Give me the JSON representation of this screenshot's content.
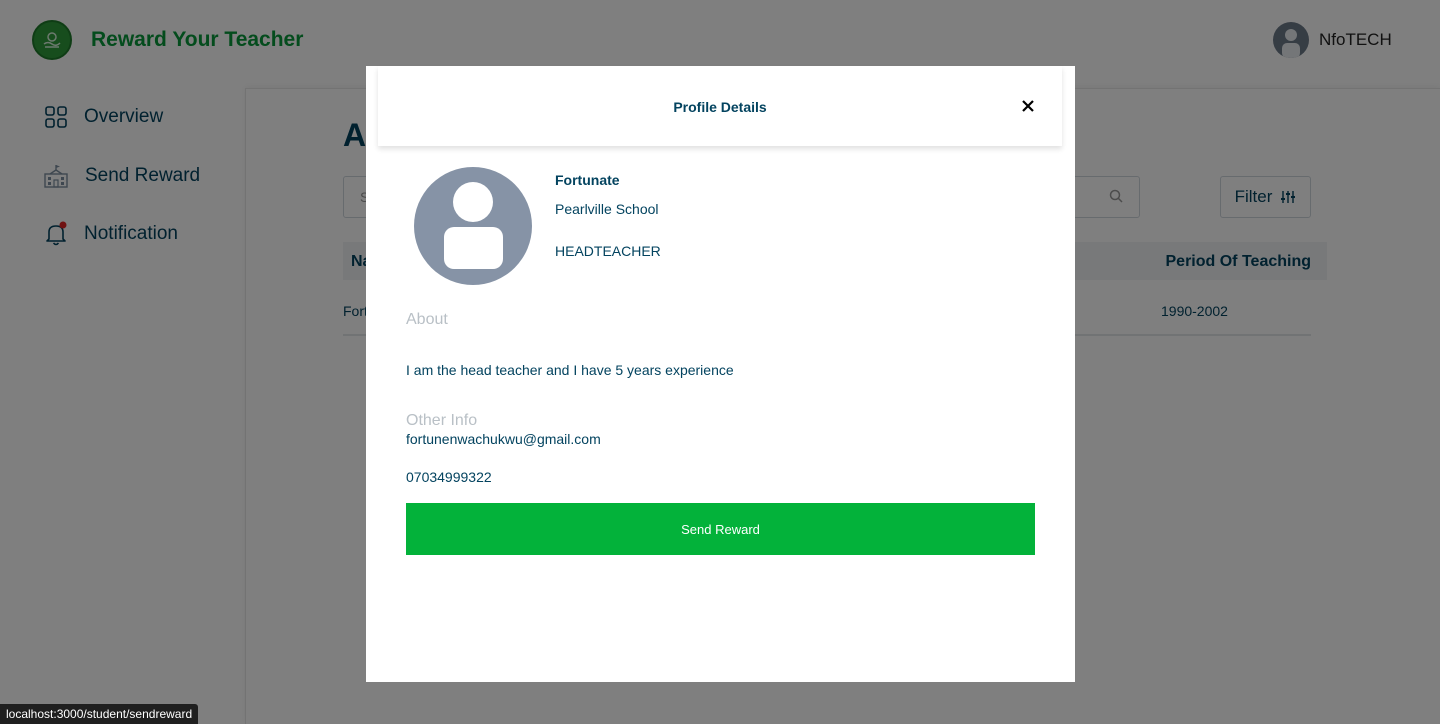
{
  "header": {
    "brand": "Reward Your Teacher",
    "user_name": "NfoTECH"
  },
  "sidebar": {
    "items": [
      {
        "label": "Overview",
        "icon": "grid-icon"
      },
      {
        "label": "Send Reward",
        "icon": "school-building-icon"
      },
      {
        "label": "Notification",
        "icon": "bell-icon"
      }
    ]
  },
  "main": {
    "title": "A",
    "search_placeholder": "S",
    "filter_label": "Filter",
    "table": {
      "headers": [
        "Na",
        "Period Of Teaching"
      ],
      "rows": [
        {
          "name": "Fort",
          "period": "1990-2002"
        }
      ]
    }
  },
  "modal": {
    "title": "Profile Details",
    "close": "×",
    "name": "Fortunate",
    "school": "Pearlville School",
    "role": "HEADTEACHER",
    "about_label": "About",
    "about_text": "I am the head teacher and I have 5 years experience",
    "other_info_label": "Other Info",
    "email": "fortunenwachukwu@gmail.com",
    "phone": "07034999322",
    "send_button": "Send Reward"
  },
  "statusbar": {
    "url": "localhost:3000/student/sendreward"
  },
  "colors": {
    "brand_green": "#08983a",
    "button_green": "#03b23a",
    "text_navy": "#03435F",
    "notification_dot": "#e02424"
  }
}
